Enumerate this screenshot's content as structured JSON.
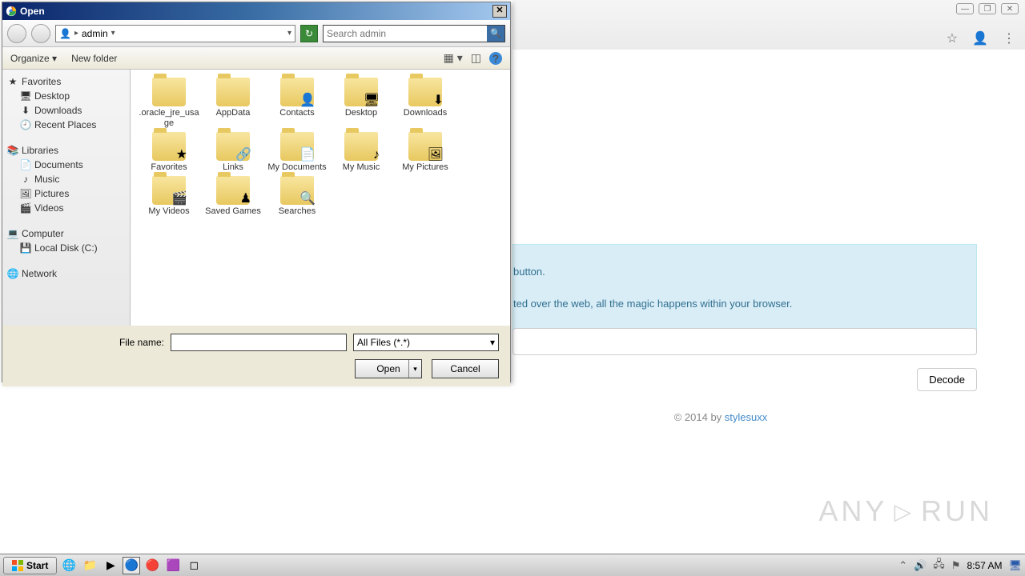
{
  "browser": {
    "controls": {
      "min": "—",
      "max": "❐",
      "close": "✕"
    }
  },
  "dialog": {
    "title": "Open",
    "breadcrumb": {
      "folder": "admin"
    },
    "search": {
      "placeholder": "Search admin"
    },
    "toolbar": {
      "organize": "Organize",
      "newfolder": "New folder"
    },
    "sidebar": {
      "favorites": {
        "label": "Favorites",
        "items": [
          "Desktop",
          "Downloads",
          "Recent Places"
        ]
      },
      "libraries": {
        "label": "Libraries",
        "items": [
          "Documents",
          "Music",
          "Pictures",
          "Videos"
        ]
      },
      "computer": {
        "label": "Computer",
        "items": [
          "Local Disk (C:)"
        ]
      },
      "network": {
        "label": "Network"
      }
    },
    "files": [
      {
        "name": ".oracle_jre_usage",
        "overlay": ""
      },
      {
        "name": "AppData",
        "overlay": ""
      },
      {
        "name": "Contacts",
        "overlay": "👤"
      },
      {
        "name": "Desktop",
        "overlay": "🖥"
      },
      {
        "name": "Downloads",
        "overlay": "⬇"
      },
      {
        "name": "Favorites",
        "overlay": "★"
      },
      {
        "name": "Links",
        "overlay": "🔗"
      },
      {
        "name": "My Documents",
        "overlay": "📄"
      },
      {
        "name": "My Music",
        "overlay": "♪"
      },
      {
        "name": "My Pictures",
        "overlay": "🖼"
      },
      {
        "name": "My Videos",
        "overlay": "🎬"
      },
      {
        "name": "Saved Games",
        "overlay": "♟"
      },
      {
        "name": "Searches",
        "overlay": "🔍"
      }
    ],
    "filename_label": "File name:",
    "filter": "All Files (*.*)",
    "open_label": "Open",
    "cancel_label": "Cancel"
  },
  "webpage": {
    "info_line1": "button.",
    "info_line2": "ted over the web, all the magic happens within your browser.",
    "decode": "Decode",
    "footer_pre": "© 2014 by ",
    "footer_link": "stylesuxx"
  },
  "taskbar": {
    "start": "Start",
    "clock": "8:57 AM"
  },
  "watermark": {
    "left": "ANY",
    "right": "RUN"
  }
}
